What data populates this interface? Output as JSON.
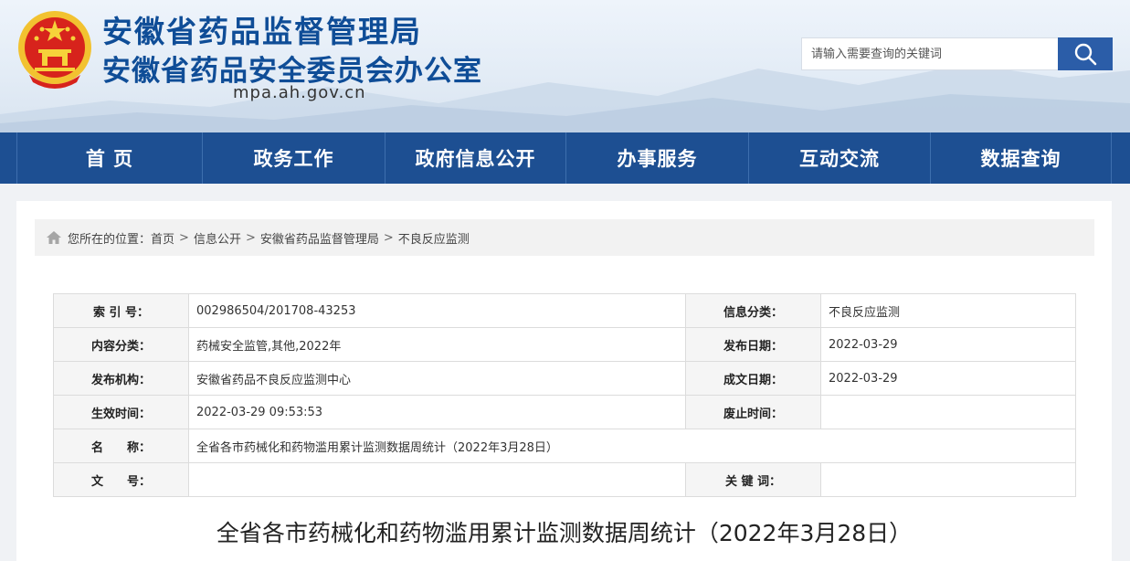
{
  "header": {
    "title": "安徽省药品监督管理局",
    "subtitle": "安徽省药品安全委员会办公室",
    "domain": "mpa.ah.gov.cn",
    "emblem_icon": "national-emblem-icon"
  },
  "search": {
    "placeholder": "请输入需要查询的关键词",
    "value": "",
    "button_icon": "search-icon"
  },
  "nav": {
    "items": [
      {
        "label": "首 页"
      },
      {
        "label": "政务工作"
      },
      {
        "label": "政府信息公开"
      },
      {
        "label": "办事服务"
      },
      {
        "label": "互动交流"
      },
      {
        "label": "数据查询"
      }
    ]
  },
  "breadcrumb": {
    "prefix": "您所在的位置：",
    "items": [
      "首页",
      "信息公开",
      "安徽省药品监督管理局",
      "不良反应监测"
    ],
    "separator": ">"
  },
  "meta": {
    "index_label": "索 引 号：",
    "index_value": "002986504/201708-43253",
    "info_class_label": "信息分类：",
    "info_class_value": "不良反应监测",
    "content_class_label": "内容分类：",
    "content_class_value": "药械安全监管,其他,2022年",
    "publish_date_label": "发布日期：",
    "publish_date_value": "2022-03-29",
    "publisher_label": "发布机构：",
    "publisher_value": "安徽省药品不良反应监测中心",
    "written_date_label": "成文日期：",
    "written_date_value": "2022-03-29",
    "effective_label": "生效时间：",
    "effective_value": "2022-03-29 09:53:53",
    "expire_label": "废止时间：",
    "expire_value": "",
    "name_label": "名　　称：",
    "name_value": "全省各市药械化和药物滥用累计监测数据周统计（2022年3月28日）",
    "doc_no_label": "文　　号：",
    "doc_no_value": "",
    "keywords_label": "关 键 词：",
    "keywords_value": ""
  },
  "article": {
    "title": "全省各市药械化和药物滥用累计监测数据周统计（2022年3月28日）"
  },
  "colors": {
    "brand_blue": "#1d4f92",
    "title_blue": "#0f4d97",
    "search_button": "#2b5da8"
  }
}
